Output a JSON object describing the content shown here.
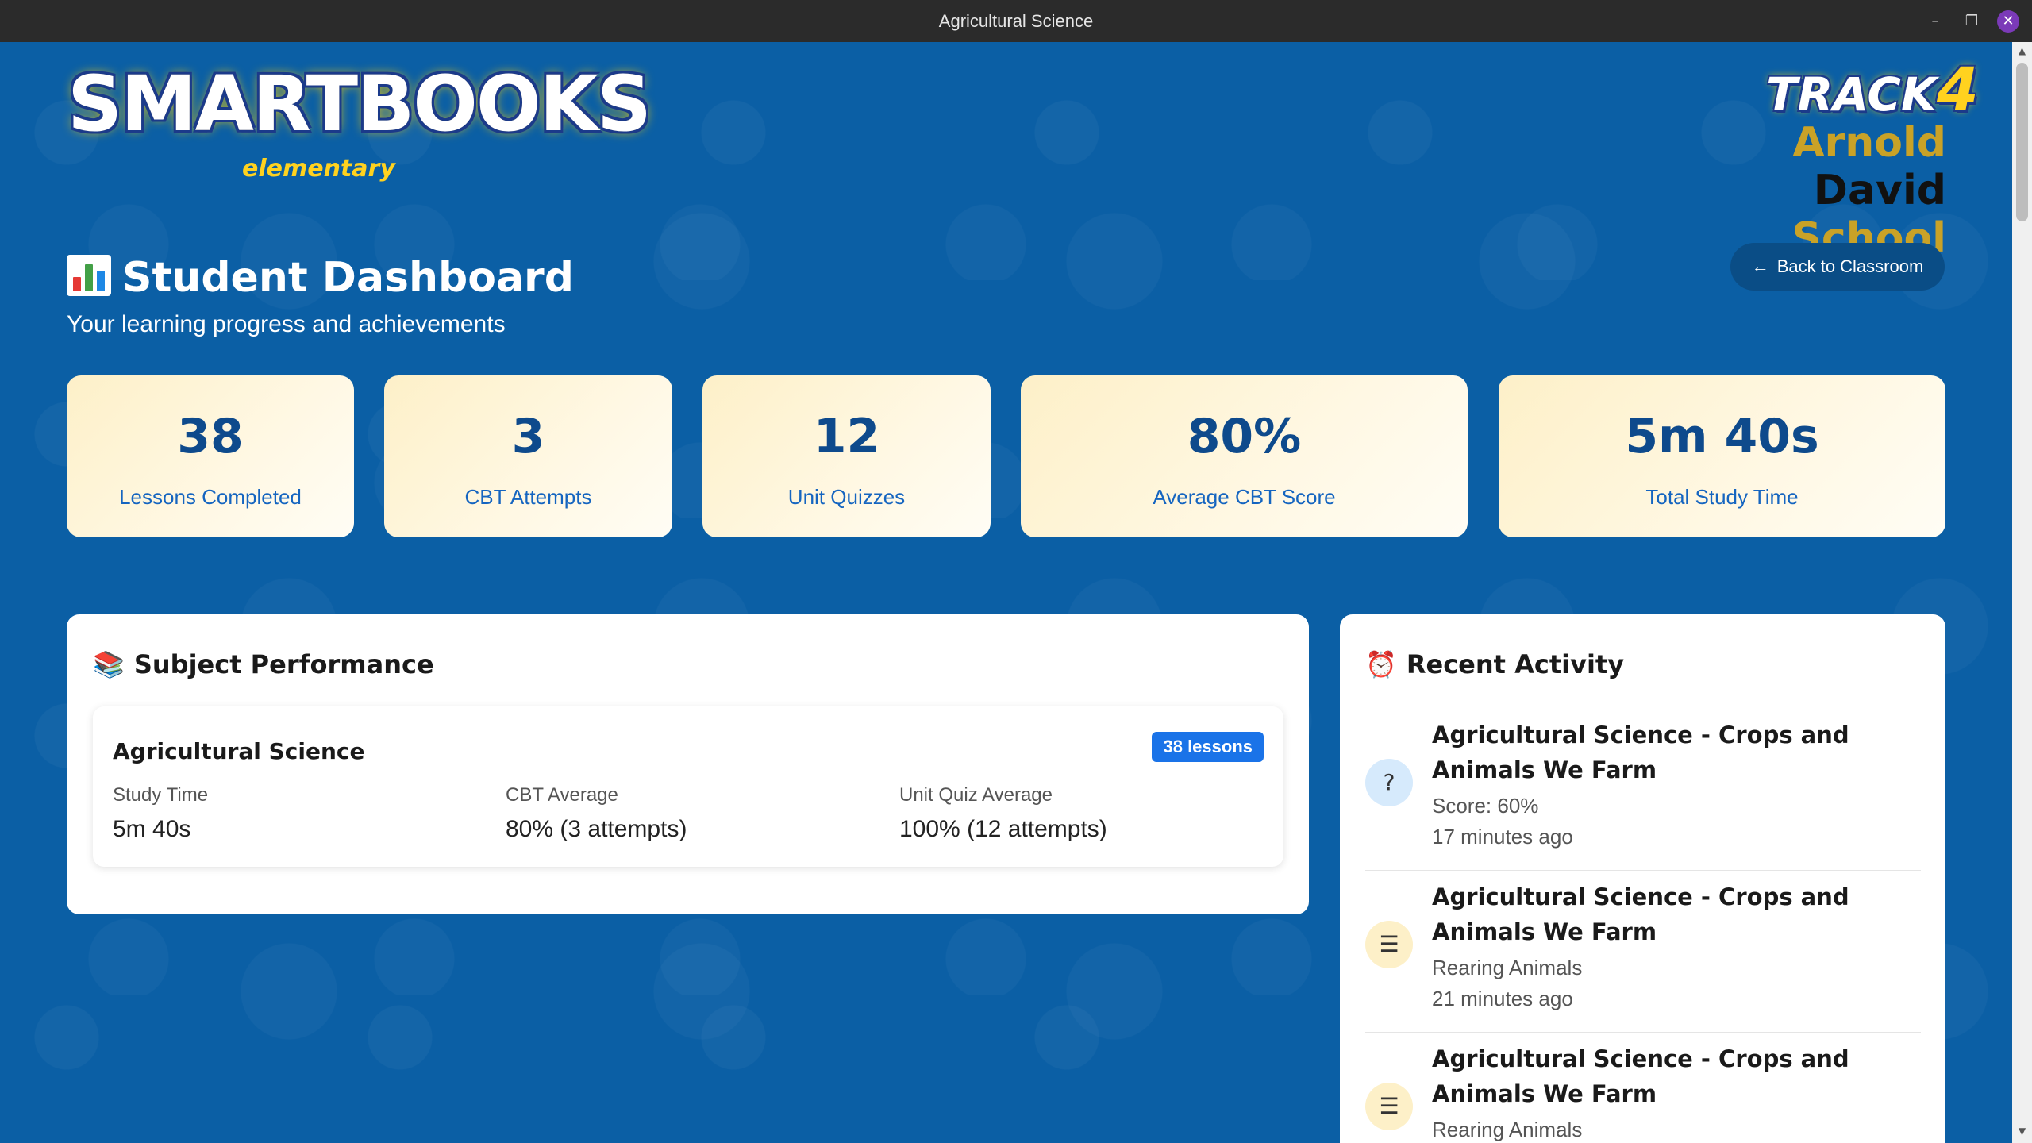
{
  "window": {
    "title": "Agricultural Science",
    "minimize_glyph": "–",
    "maximize_glyph": "❐",
    "close_glyph": "✕"
  },
  "brand": {
    "logo_text": "SMARTBOOKS",
    "logo_sub": "elementary",
    "track_text": "TRACK",
    "track_num": "4",
    "school_part1": "Arnold",
    "school_part2": "David",
    "school_part3": "School"
  },
  "header": {
    "title": "Student Dashboard",
    "subtitle": "Your learning progress and achievements",
    "back_button": "Back to Classroom",
    "back_arrow": "←"
  },
  "stats": [
    {
      "value": "38",
      "label": "Lessons Completed"
    },
    {
      "value": "3",
      "label": "CBT Attempts"
    },
    {
      "value": "12",
      "label": "Unit Quizzes"
    },
    {
      "value": "80%",
      "label": "Average CBT Score"
    },
    {
      "value": "5m 40s",
      "label": "Total Study Time"
    }
  ],
  "subject_performance": {
    "title": "Subject Performance",
    "icon": "📚",
    "subject": {
      "name": "Agricultural Science",
      "badge": "38 lessons",
      "metrics": [
        {
          "label": "Study Time",
          "value": "5m 40s"
        },
        {
          "label": "CBT Average",
          "value": "80% (3 attempts)"
        },
        {
          "label": "Unit Quiz Average",
          "value": "100% (12 attempts)"
        }
      ]
    }
  },
  "recent_activity": {
    "title": "Recent Activity",
    "icon": "⏰",
    "items": [
      {
        "icon": "question-circle-icon",
        "glyph": "?",
        "title": "Agricultural Science - Crops and Animals We Farm",
        "line1": "Score: 60%",
        "line2": "17 minutes ago",
        "bg": "#d6eafc"
      },
      {
        "icon": "document-list-icon",
        "glyph": "☰",
        "title": "Agricultural Science - Crops and Animals We Farm",
        "line1": "Rearing Animals",
        "line2": "21 minutes ago",
        "bg": "#fdf0c8"
      },
      {
        "icon": "document-list-icon",
        "glyph": "☰",
        "title": "Agricultural Science - Crops and Animals We Farm",
        "line1": "Rearing Animals",
        "line2": "",
        "bg": "#fdf0c8"
      }
    ]
  },
  "colors": {
    "background": "#0b5fa5",
    "stat_value": "#0e4a8c",
    "stat_label": "#1565c0",
    "badge": "#1a73e8"
  }
}
